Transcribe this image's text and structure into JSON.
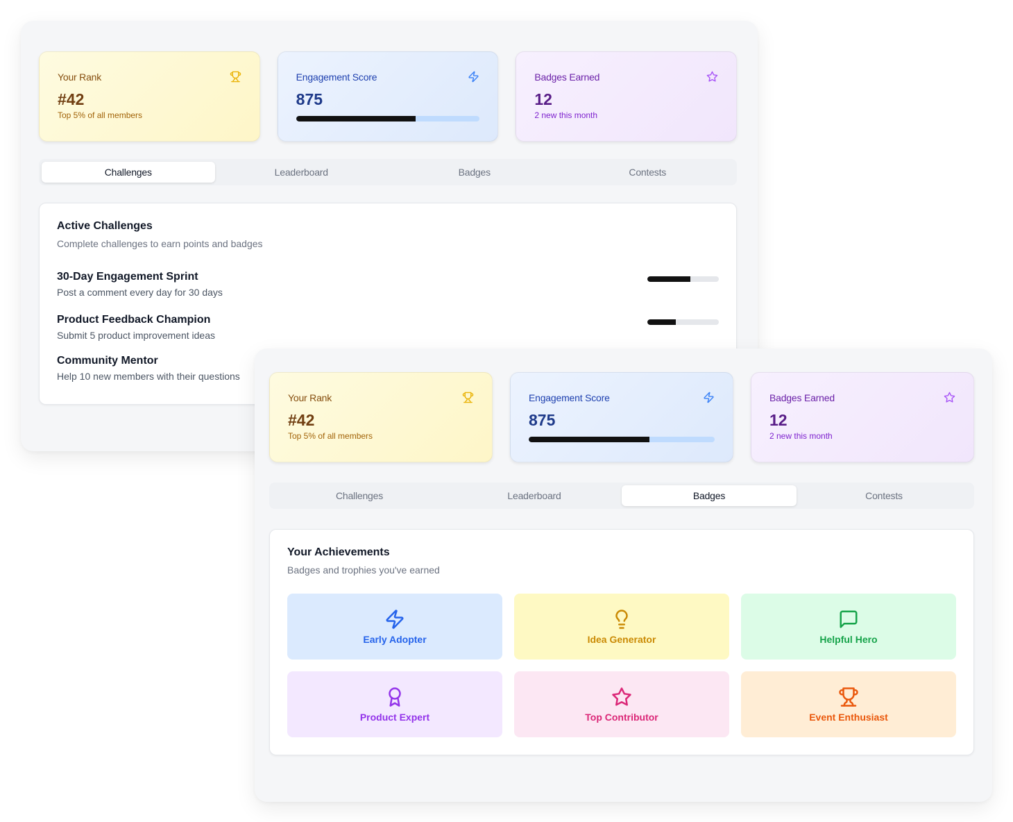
{
  "windows": [
    {
      "stats": {
        "rank": {
          "label": "Your Rank",
          "value": "#42",
          "sub": "Top 5% of all members",
          "icon": "trophy-icon"
        },
        "engagement": {
          "label": "Engagement Score",
          "value": "875",
          "progress_percent": 65,
          "icon": "lightning-icon"
        },
        "badges": {
          "label": "Badges Earned",
          "value": "12",
          "sub": "2 new this month",
          "icon": "star-icon"
        }
      },
      "tabs": [
        {
          "label": "Challenges",
          "active": true
        },
        {
          "label": "Leaderboard",
          "active": false
        },
        {
          "label": "Badges",
          "active": false
        },
        {
          "label": "Contests",
          "active": false
        }
      ],
      "panel": {
        "title": "Active Challenges",
        "subtitle": "Complete challenges to earn points and badges",
        "challenges": [
          {
            "name": "30-Day Engagement Sprint",
            "description": "Post a comment every day for 30 days",
            "progress_percent": 60
          },
          {
            "name": "Product Feedback Champion",
            "description": "Submit 5 product improvement ideas",
            "progress_percent": 40
          },
          {
            "name": "Community Mentor",
            "description": "Help 10 new members with their questions"
          }
        ]
      }
    },
    {
      "stats": {
        "rank": {
          "label": "Your Rank",
          "value": "#42",
          "sub": "Top 5% of all members",
          "icon": "trophy-icon"
        },
        "engagement": {
          "label": "Engagement Score",
          "value": "875",
          "progress_percent": 65,
          "icon": "lightning-icon"
        },
        "badges": {
          "label": "Badges Earned",
          "value": "12",
          "sub": "2 new this month",
          "icon": "star-icon"
        }
      },
      "tabs": [
        {
          "label": "Challenges",
          "active": false
        },
        {
          "label": "Leaderboard",
          "active": false
        },
        {
          "label": "Badges",
          "active": true
        },
        {
          "label": "Contests",
          "active": false
        }
      ],
      "panel": {
        "title": "Your Achievements",
        "subtitle": "Badges and trophies you've earned",
        "badges": [
          {
            "name": "Early Adopter",
            "icon": "lightning-icon",
            "bg": "#dbeafe",
            "color": "#2563eb"
          },
          {
            "name": "Idea Generator",
            "icon": "lightbulb-icon",
            "bg": "#fef9c3",
            "color": "#ca8a04"
          },
          {
            "name": "Helpful Hero",
            "icon": "message-square-icon",
            "bg": "#dcfce7",
            "color": "#16a34a"
          },
          {
            "name": "Product Expert",
            "icon": "award-icon",
            "bg": "#f3e8ff",
            "color": "#9333ea"
          },
          {
            "name": "Top Contributor",
            "icon": "star-icon",
            "bg": "#fce7f3",
            "color": "#db2777"
          },
          {
            "name": "Event Enthusiast",
            "icon": "trophy-icon",
            "bg": "#ffedd5",
            "color": "#ea580c"
          }
        ]
      }
    }
  ],
  "colors": {
    "rank_icon": "#eab308",
    "engagement_icon": "#3b82f6",
    "badges_icon": "#a855f7"
  }
}
